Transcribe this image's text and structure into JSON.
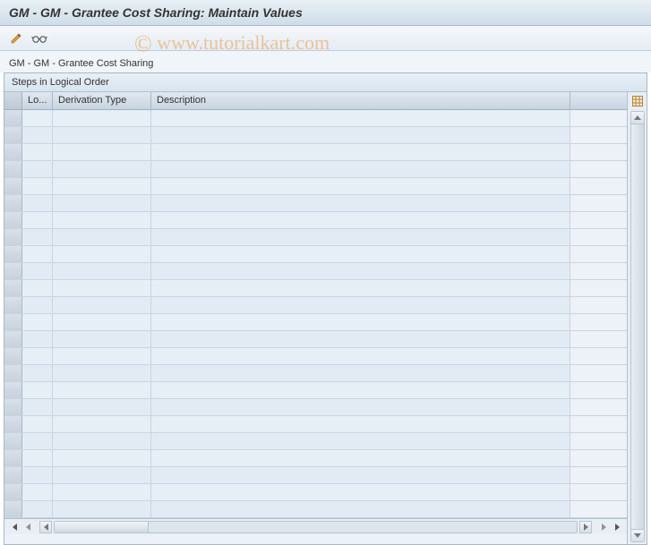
{
  "title": "GM - GM - Grantee Cost Sharing: Maintain Values",
  "subtitle": "GM - GM - Grantee Cost Sharing",
  "panel": {
    "header": "Steps in Logical Order",
    "columns": {
      "lo": "Lo...",
      "derivation_type": "Derivation Type",
      "description": "Description"
    },
    "rows": [
      {
        "lo": "",
        "derivation_type": "",
        "description": ""
      },
      {
        "lo": "",
        "derivation_type": "",
        "description": ""
      },
      {
        "lo": "",
        "derivation_type": "",
        "description": ""
      },
      {
        "lo": "",
        "derivation_type": "",
        "description": ""
      },
      {
        "lo": "",
        "derivation_type": "",
        "description": ""
      },
      {
        "lo": "",
        "derivation_type": "",
        "description": ""
      },
      {
        "lo": "",
        "derivation_type": "",
        "description": ""
      },
      {
        "lo": "",
        "derivation_type": "",
        "description": ""
      },
      {
        "lo": "",
        "derivation_type": "",
        "description": ""
      },
      {
        "lo": "",
        "derivation_type": "",
        "description": ""
      },
      {
        "lo": "",
        "derivation_type": "",
        "description": ""
      },
      {
        "lo": "",
        "derivation_type": "",
        "description": ""
      },
      {
        "lo": "",
        "derivation_type": "",
        "description": ""
      },
      {
        "lo": "",
        "derivation_type": "",
        "description": ""
      },
      {
        "lo": "",
        "derivation_type": "",
        "description": ""
      },
      {
        "lo": "",
        "derivation_type": "",
        "description": ""
      },
      {
        "lo": "",
        "derivation_type": "",
        "description": ""
      },
      {
        "lo": "",
        "derivation_type": "",
        "description": ""
      },
      {
        "lo": "",
        "derivation_type": "",
        "description": ""
      },
      {
        "lo": "",
        "derivation_type": "",
        "description": ""
      },
      {
        "lo": "",
        "derivation_type": "",
        "description": ""
      },
      {
        "lo": "",
        "derivation_type": "",
        "description": ""
      },
      {
        "lo": "",
        "derivation_type": "",
        "description": ""
      },
      {
        "lo": "",
        "derivation_type": "",
        "description": ""
      }
    ]
  },
  "toolbar_icons": {
    "edit": "pencil-icon",
    "glasses": "glasses-icon"
  },
  "watermark": "© www.tutorialkart.com"
}
